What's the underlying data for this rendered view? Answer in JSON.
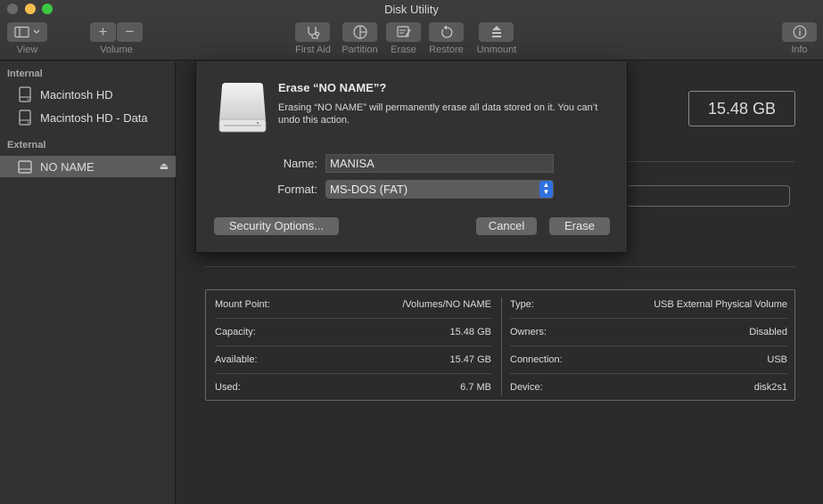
{
  "window": {
    "title": "Disk Utility"
  },
  "toolbar": {
    "view_label": "View",
    "volume_label": "Volume",
    "first_aid_label": "First Aid",
    "partition_label": "Partition",
    "erase_label": "Erase",
    "restore_label": "Restore",
    "unmount_label": "Unmount",
    "info_label": "Info",
    "add_glyph": "+",
    "remove_glyph": "−"
  },
  "sidebar": {
    "internal_header": "Internal",
    "external_header": "External",
    "items": [
      {
        "label": "Macintosh HD",
        "icon": "internal-disk-icon"
      },
      {
        "label": "Macintosh HD - Data",
        "icon": "internal-disk-icon"
      },
      {
        "label": "NO NAME",
        "icon": "external-disk-icon",
        "selected": true
      }
    ],
    "eject_glyph": "⏏"
  },
  "volume": {
    "size": "15.48 GB"
  },
  "info": {
    "rows": [
      {
        "left_label": "Mount Point:",
        "left_value": "/Volumes/NO NAME",
        "right_label": "Type:",
        "right_value": "USB External Physical Volume"
      },
      {
        "left_label": "Capacity:",
        "left_value": "15.48 GB",
        "right_label": "Owners:",
        "right_value": "Disabled"
      },
      {
        "left_label": "Available:",
        "left_value": "15.47 GB",
        "right_label": "Connection:",
        "right_value": "USB"
      },
      {
        "left_label": "Used:",
        "left_value": "6.7 MB",
        "right_label": "Device:",
        "right_value": "disk2s1"
      }
    ]
  },
  "dialog": {
    "title": "Erase “NO NAME”?",
    "message": "Erasing “NO NAME” will permanently erase all data stored on it. You can’t undo this action.",
    "name_label": "Name:",
    "name_value": "MANISA",
    "format_label": "Format:",
    "format_value": "MS-DOS (FAT)",
    "security_button": "Security Options...",
    "cancel_button": "Cancel",
    "erase_button": "Erase"
  },
  "colors": {
    "accent": "#2f6fe0",
    "close": "#6b6b6b",
    "minimize": "#f5bf4f",
    "zoom": "#3cc940"
  }
}
